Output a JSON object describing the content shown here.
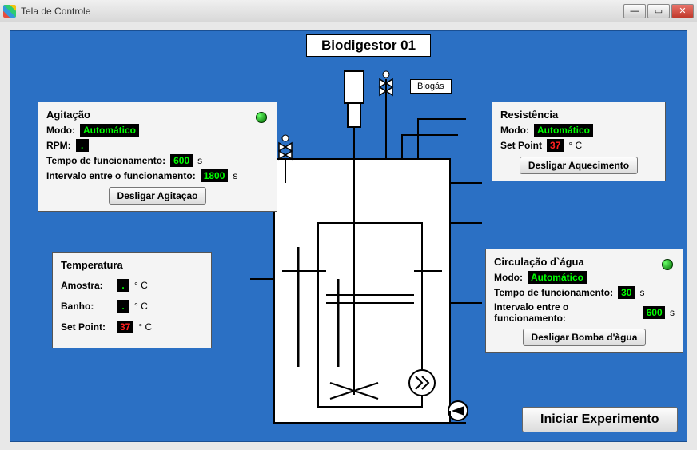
{
  "window": {
    "title": "Tela de Controle"
  },
  "header": {
    "title": "Biodigestor 01"
  },
  "agitacao": {
    "heading": "Agitação",
    "modo_label": "Modo:",
    "modo_value": "Automático",
    "rpm_label": "RPM:",
    "rpm_value": ".",
    "tempo_label": "Tempo de funcionamento:",
    "tempo_value": "600",
    "tempo_unit": "s",
    "intervalo_label": "Intervalo entre o funcionamento:",
    "intervalo_value": "1800",
    "intervalo_unit": "s",
    "button": "Desligar Agitaçao"
  },
  "temperatura": {
    "heading": "Temperatura",
    "amostra_label": "Amostra:",
    "amostra_value": ".",
    "amostra_unit": "° C",
    "banho_label": "Banho:",
    "banho_value": ".",
    "banho_unit": "° C",
    "setpoint_label": "Set Point:",
    "setpoint_value": "37",
    "setpoint_unit": "° C"
  },
  "resistencia": {
    "heading": "Resistência",
    "modo_label": "Modo:",
    "modo_value": "Automático",
    "setpoint_label": "Set Point",
    "setpoint_value": "37",
    "setpoint_unit": "° C",
    "button": "Desligar Aquecimento"
  },
  "circulacao": {
    "heading": "Circulação d`água",
    "modo_label": "Modo:",
    "modo_value": "Automático",
    "tempo_label": "Tempo de funcionamento:",
    "tempo_value": "30",
    "tempo_unit": "s",
    "intervalo_label": "Intervalo entre o funcionamento:",
    "intervalo_value": "600",
    "intervalo_unit": "s",
    "button": "Desligar Bomba d'àgua"
  },
  "biogas": {
    "label": "Biogás"
  },
  "main_button": "Iniciar Experimento"
}
